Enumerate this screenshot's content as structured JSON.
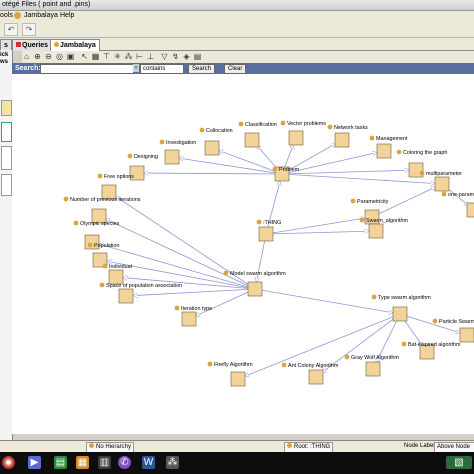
{
  "window": {
    "title": "otégé Files ( point and .pins)"
  },
  "menu": {
    "items": [
      "ools",
      "Jambalaya",
      "Help"
    ]
  },
  "tabs": [
    "s",
    "Queries",
    "Jambalaya"
  ],
  "left_panel": {
    "label": "ick ws"
  },
  "search": {
    "label": "Search:",
    "mode": "contains",
    "search_label": "Search",
    "clear_label": "Clear"
  },
  "graph": {
    "node_color": "#f2d49b",
    "dot_color": "#d9a441",
    "edge_color": "#8f96d9",
    "nodes": [
      {
        "id": "thing",
        "label": ":THING"
      },
      {
        "id": "problem",
        "label": "Problem"
      },
      {
        "id": "collocation",
        "label": "Collocation"
      },
      {
        "id": "investigation",
        "label": "Investigation"
      },
      {
        "id": "classification",
        "label": "Classification"
      },
      {
        "id": "vector",
        "label": "Vector problems"
      },
      {
        "id": "network",
        "label": "Network tasks"
      },
      {
        "id": "management",
        "label": "Management"
      },
      {
        "id": "coloring",
        "label": "Coloring the graph"
      },
      {
        "id": "designing",
        "label": "Designing"
      },
      {
        "id": "multiparam",
        "label": "multiparameter"
      },
      {
        "id": "oneparam",
        "label": "one-paramo"
      },
      {
        "id": "parametricity",
        "label": "Parametricity"
      },
      {
        "id": "swarm",
        "label": "Swarm_algorithm"
      },
      {
        "id": "model",
        "label": "Model swarm algorithm"
      },
      {
        "id": "free",
        "label": "Free options"
      },
      {
        "id": "iterations",
        "label": "Number of previous iterations"
      },
      {
        "id": "olympic",
        "label": "Olympic species"
      },
      {
        "id": "population",
        "label": "Population"
      },
      {
        "id": "individual",
        "label": "Individual"
      },
      {
        "id": "space",
        "label": "Space of population association"
      },
      {
        "id": "itertype",
        "label": "Iteration type"
      },
      {
        "id": "typeswarm",
        "label": "Type swarm algorithm"
      },
      {
        "id": "pso",
        "label": "Particle Swarm"
      },
      {
        "id": "bat",
        "label": "Bat-inspired algorithm"
      },
      {
        "id": "gwo",
        "label": "Gray Wolf Algorithm"
      },
      {
        "id": "aco",
        "label": "Ant Colony Algorithm"
      },
      {
        "id": "firefly",
        "label": "Firefly Algorithm"
      }
    ],
    "edges": [
      [
        "problem",
        "collocation"
      ],
      [
        "problem",
        "investigation"
      ],
      [
        "problem",
        "classification"
      ],
      [
        "problem",
        "vector"
      ],
      [
        "problem",
        "network"
      ],
      [
        "problem",
        "management"
      ],
      [
        "problem",
        "coloring"
      ],
      [
        "problem",
        "designing"
      ],
      [
        "problem",
        "multiparam"
      ],
      [
        "thing",
        "problem"
      ],
      [
        "thing",
        "swarm"
      ],
      [
        "thing",
        "model"
      ],
      [
        "thing",
        "parametricity"
      ],
      [
        "multiparam",
        "oneparam"
      ],
      [
        "parametricity",
        "multiparam"
      ],
      [
        "model",
        "free"
      ],
      [
        "model",
        "iterations"
      ],
      [
        "model",
        "olympic"
      ],
      [
        "model",
        "population"
      ],
      [
        "model",
        "individual"
      ],
      [
        "model",
        "space"
      ],
      [
        "model",
        "itertype"
      ],
      [
        "model",
        "typeswarm"
      ],
      [
        "typeswarm",
        "pso"
      ],
      [
        "typeswarm",
        "bat"
      ],
      [
        "typeswarm",
        "gwo"
      ],
      [
        "typeswarm",
        "aco"
      ],
      [
        "typeswarm",
        "firefly"
      ]
    ]
  },
  "status": {
    "hierarchy": "No Hierarchy",
    "root": "Root: :THING",
    "node_labels_label": "Node Labels:",
    "node_labels_value": "Above Node"
  },
  "taskbar": {
    "icons": [
      "windows-start-icon",
      "media-player-icon",
      "folder-icon",
      "terminal-icon",
      "chart-icon",
      "viber-icon",
      "word-icon",
      "network-icon",
      "photos-icon"
    ]
  }
}
